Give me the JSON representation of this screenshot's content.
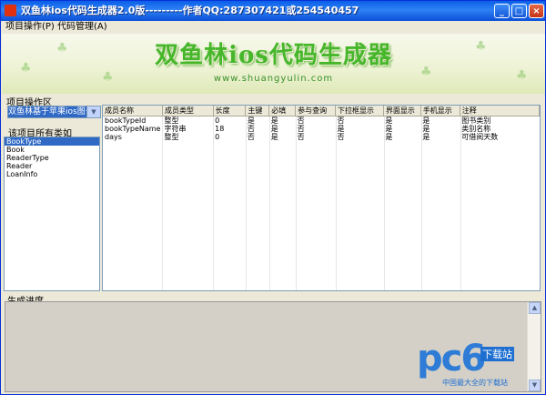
{
  "window": {
    "title": "双鱼林ios代码生成器2.0版---------作者QQ:287307421或254540457",
    "buttons": {
      "minimize": "_",
      "maximize": "□",
      "close": "×"
    }
  },
  "menu": [
    "项目操作(P)",
    "代码管理(A)"
  ],
  "banner": {
    "title": "双鱼林ios代码生成器",
    "url": "www.shuangyulin.com"
  },
  "project_section": {
    "label": "项目操作区",
    "selected_project": "双鱼林基于苹果ios图书"
  },
  "class_section": {
    "label": "该项目所有类如",
    "classes": [
      "BookType",
      "Book",
      "ReaderType",
      "Reader",
      "LoanInfo"
    ],
    "selected_index": 0
  },
  "grid": {
    "headers": [
      "成员名称",
      "成员类型",
      "长度",
      "主键",
      "必填",
      "参与查询",
      "下拉框显示",
      "界面显示",
      "手机显示",
      "注释"
    ],
    "rows": [
      [
        "bookTypeId",
        "整型",
        "0",
        "是",
        "是",
        "否",
        "否",
        "是",
        "是",
        "图书类别"
      ],
      [
        "bookTypeName",
        "字符串",
        "18",
        "否",
        "是",
        "否",
        "是",
        "是",
        "是",
        "类别名称"
      ],
      [
        "days",
        "整型",
        "0",
        "否",
        "是",
        "否",
        "否",
        "是",
        "是",
        "可借阅天数"
      ]
    ]
  },
  "progress": {
    "label": "生成进度"
  },
  "watermark": {
    "logo": "pc6",
    "tag": "下载站",
    "slogan": "中国最大全的下载站"
  }
}
